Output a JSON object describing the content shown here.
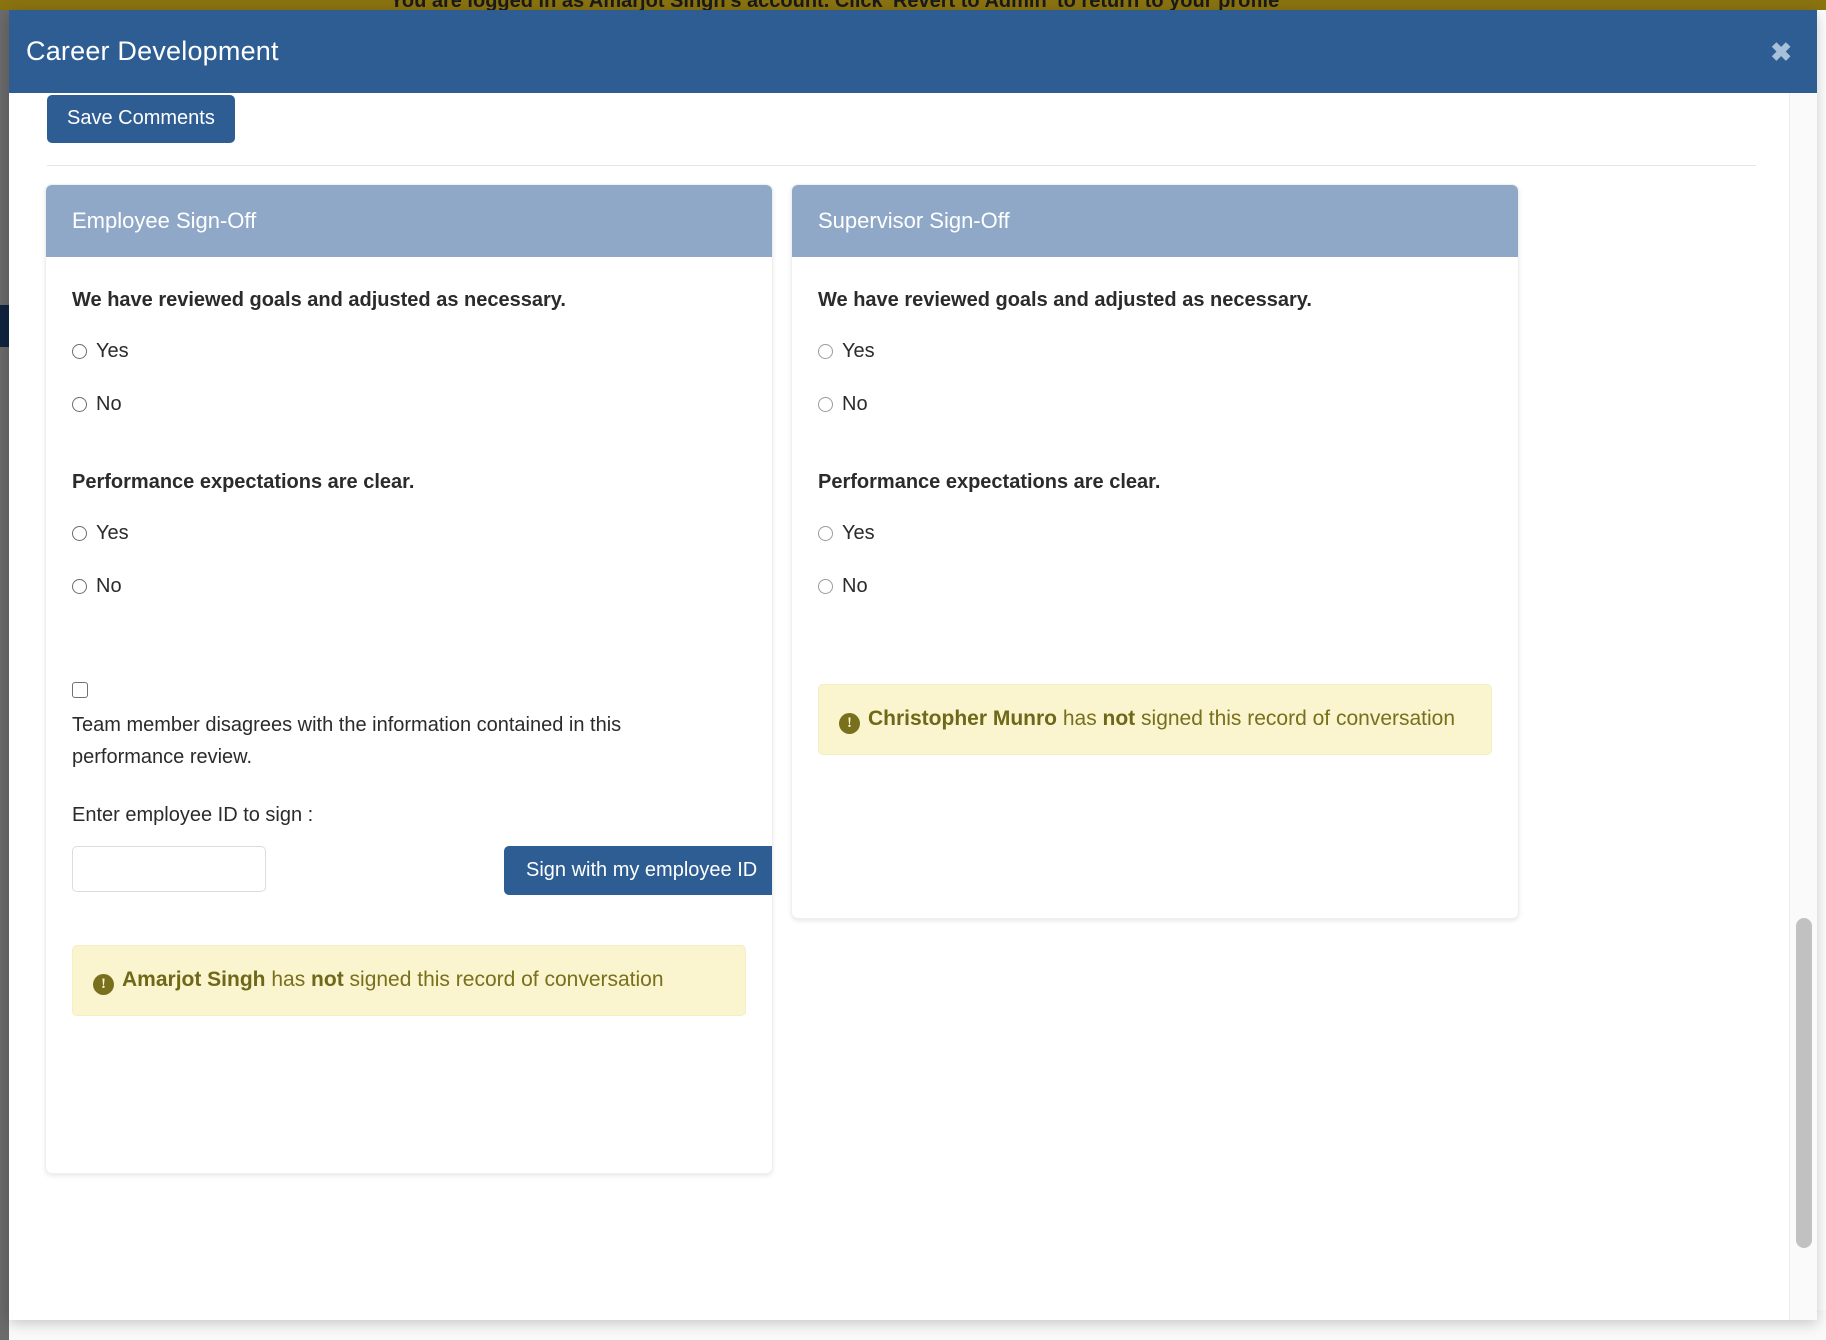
{
  "background": {
    "banner_text": "You are logged in as Amarjot Singh's account. Click 'Revert to Admin' to return to your profile"
  },
  "modal": {
    "title": "Career Development",
    "close_icon": "close-icon",
    "close_glyph": "✖"
  },
  "toolbar": {
    "save_comments_label": "Save Comments"
  },
  "employee_panel": {
    "header": "Employee Sign-Off",
    "question_1": "We have reviewed goals and adjusted as necessary.",
    "q1_yes": "Yes",
    "q1_no": "No",
    "question_2": "Performance expectations are clear.",
    "q2_yes": "Yes",
    "q2_no": "No",
    "disagree_text": " Team member disagrees with the information contained in this performance review.",
    "id_label": "Enter employee ID to sign :",
    "id_value": "",
    "id_placeholder": "",
    "sign_button": "Sign with my employee ID",
    "alert": {
      "icon": "exclamation-circle-icon",
      "icon_glyph": "!",
      "name": "Amarjot Singh",
      "middle": " has ",
      "emphasis": "not",
      "tail": " signed this record of conversation"
    }
  },
  "supervisor_panel": {
    "header": "Supervisor Sign-Off",
    "question_1": "We have reviewed goals and adjusted as necessary.",
    "q1_yes": "Yes",
    "q1_no": "No",
    "question_2": "Performance expectations are clear.",
    "q2_yes": "Yes",
    "q2_no": "No",
    "alert": {
      "icon": "exclamation-circle-icon",
      "icon_glyph": "!",
      "name": "Christopher Munro",
      "middle": " has ",
      "emphasis": "not",
      "tail": " signed this record of conversation"
    }
  },
  "colors": {
    "modal_header": "#2d5d92",
    "card_header": "#8fa8c8",
    "primary_button": "#2d5d92",
    "alert_warning_bg": "#faf4cf",
    "alert_warning_text": "#78701c",
    "banner_bg": "#8a7310"
  },
  "scrollbar": {
    "orientation": "vertical",
    "thumb_position_percent": 72
  }
}
